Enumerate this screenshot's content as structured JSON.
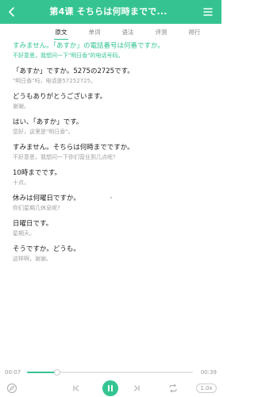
{
  "header": {
    "title": "第4课 そちらは何時までで..."
  },
  "tabs": [
    {
      "label": "原文",
      "active": true
    },
    {
      "label": "单词",
      "active": false
    },
    {
      "label": "语法",
      "active": false
    },
    {
      "label": "评测",
      "active": false
    },
    {
      "label": "排行",
      "active": false
    }
  ],
  "entries": [
    {
      "jp": "すみません。「あすか」の電話番号は何番ですか。",
      "cn": "不好意思，我想问一下\"明日香\"的电话号码。",
      "active": true
    },
    {
      "jp": "「あすか」ですか。5275の2725です。",
      "cn": "\"明日香\"吗，电话是57252725。",
      "active": false
    },
    {
      "jp": "どうもありがとうございます。",
      "cn": "谢谢。",
      "active": false
    },
    {
      "jp": "はい、「あすか」です。",
      "cn": "您好，这里是\"明日香\"。",
      "active": false
    },
    {
      "jp": "すみません。そちらは何時までですか。",
      "cn": "不好意思，我想问一下你们营业到几点呢?",
      "active": false
    },
    {
      "jp": "10時までです。",
      "cn": "十点。",
      "active": false
    },
    {
      "jp": "休みは何曜日ですか。",
      "cn": "你们星期几休息呢?",
      "active": false
    },
    {
      "jp": "日曜日です。",
      "cn": "星期天。",
      "active": false
    },
    {
      "jp": "そうですか。どうも。",
      "cn": "这样啊，谢谢。",
      "active": false
    }
  ],
  "player": {
    "current_time": "00:07",
    "total_time": "00:39",
    "progress": 0.18,
    "speed": "1.0x"
  },
  "colors": {
    "accent": "#35c491"
  },
  "icons": {
    "back": "chevron-left-icon",
    "menu": "list-icon",
    "compass": "compass-icon",
    "prev": "skip-previous-icon",
    "play_pause": "pause-icon",
    "next": "skip-next-icon",
    "repeat": "repeat-icon"
  }
}
